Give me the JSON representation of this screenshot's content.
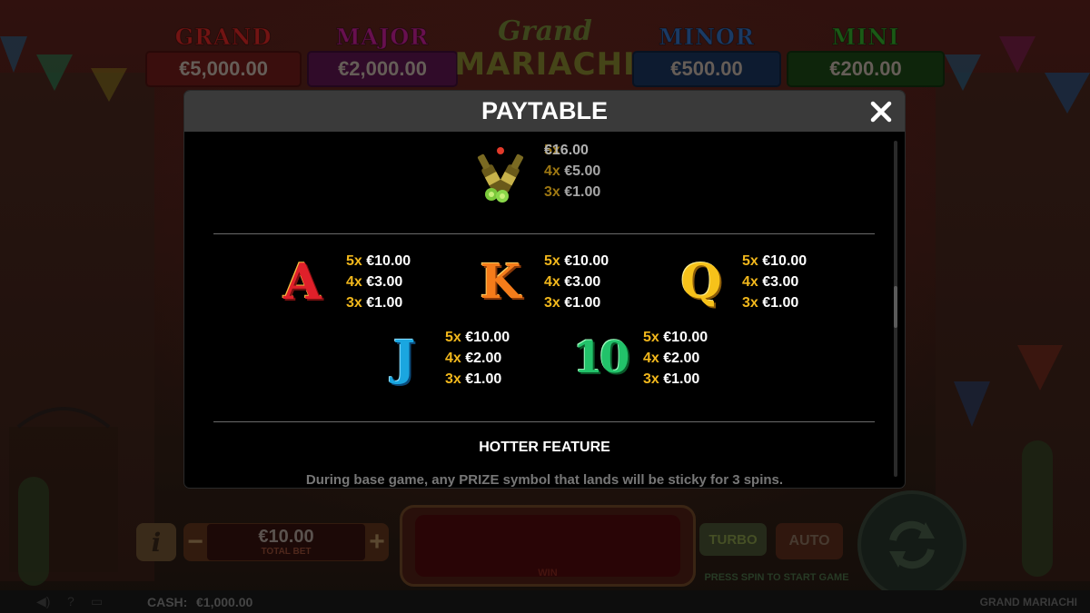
{
  "jackpots": [
    {
      "name": "GRAND",
      "value": "€5,000.00",
      "title_color": "#b0201e",
      "box_color": "#8a1a18"
    },
    {
      "name": "MAJOR",
      "value": "€2,000.00",
      "title_color": "#b0207e",
      "box_color": "#7a1860"
    },
    {
      "name": "MINOR",
      "value": "€500.00",
      "title_color": "#2a6ab0",
      "box_color": "#1e4a8a"
    },
    {
      "name": "MINI",
      "value": "€200.00",
      "title_color": "#3aa02a",
      "box_color": "#2a7a1e"
    }
  ],
  "logo": {
    "line1": "Grand",
    "line2": "MARIACHI"
  },
  "paytable": {
    "title": "PAYTABLE",
    "close_icon": "close-icon",
    "premium_symbol": {
      "icon": "beer-bottles-icon",
      "pays": [
        {
          "count": "5x",
          "value": "€16.00"
        },
        {
          "count": "4x",
          "value": "€5.00"
        },
        {
          "count": "3x",
          "value": "€1.00"
        }
      ]
    },
    "symbols": [
      {
        "glyph": "A",
        "pays": [
          {
            "count": "5x",
            "value": "€10.00"
          },
          {
            "count": "4x",
            "value": "€3.00"
          },
          {
            "count": "3x",
            "value": "€1.00"
          }
        ]
      },
      {
        "glyph": "K",
        "pays": [
          {
            "count": "5x",
            "value": "€10.00"
          },
          {
            "count": "4x",
            "value": "€3.00"
          },
          {
            "count": "3x",
            "value": "€1.00"
          }
        ]
      },
      {
        "glyph": "Q",
        "pays": [
          {
            "count": "5x",
            "value": "€10.00"
          },
          {
            "count": "4x",
            "value": "€3.00"
          },
          {
            "count": "3x",
            "value": "€1.00"
          }
        ]
      },
      {
        "glyph": "J",
        "pays": [
          {
            "count": "5x",
            "value": "€10.00"
          },
          {
            "count": "4x",
            "value": "€2.00"
          },
          {
            "count": "3x",
            "value": "€1.00"
          }
        ]
      },
      {
        "glyph": "10",
        "pays": [
          {
            "count": "5x",
            "value": "€10.00"
          },
          {
            "count": "4x",
            "value": "€2.00"
          },
          {
            "count": "3x",
            "value": "€1.00"
          }
        ]
      }
    ],
    "feature_title": "HOTTER FEATURE",
    "feature_text": "During base game, any PRIZE symbol that lands will be sticky for 3 spins."
  },
  "controls": {
    "info_label": "i",
    "minus_label": "−",
    "plus_label": "+",
    "total_bet_value": "€10.00",
    "total_bet_label": "TOTAL BET",
    "win_label": "WIN",
    "turbo_label": "TURBO",
    "auto_label": "AUTO",
    "press_spin_text": "PRESS SPIN TO START GAME",
    "spin_icon": "spin-arrows-icon"
  },
  "footer": {
    "cash_label": "CASH:",
    "cash_value": "€1,000.00",
    "game_name": "GRAND MARIACHI",
    "icons": [
      "sound-icon",
      "help-icon",
      "settings-icon"
    ]
  }
}
